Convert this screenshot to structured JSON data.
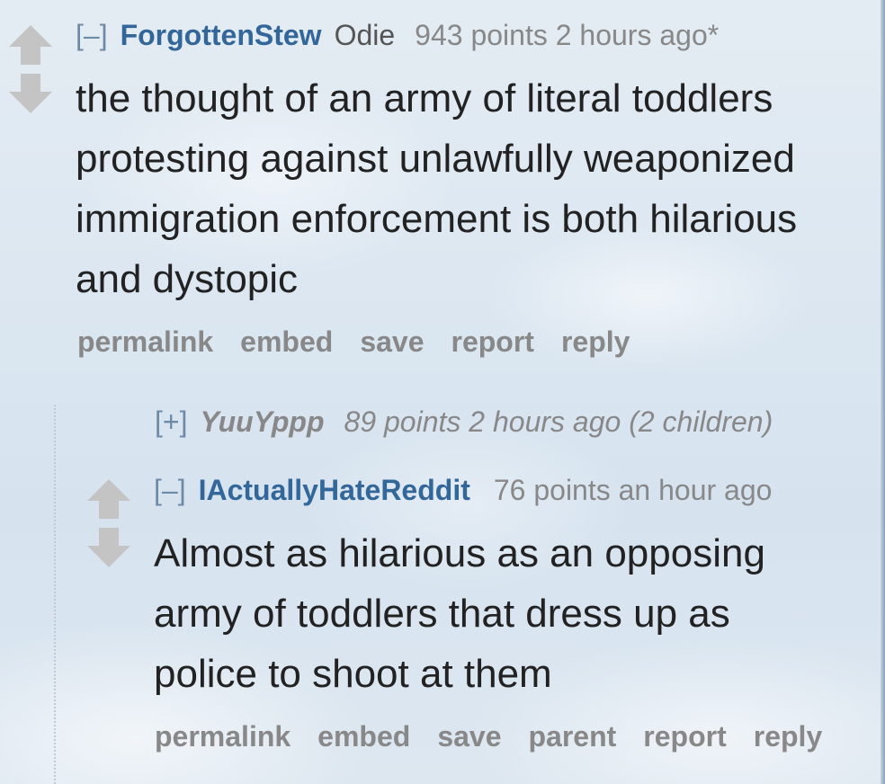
{
  "comments": [
    {
      "expand_toggle": "[–]",
      "author": "ForgottenStew",
      "flair": "Odie",
      "score": "943 points",
      "time": "2 hours ago*",
      "body": "the thought of an army of literal toddlers protesting against unlawfully weaponized immigration enforcement is both hilarious and dystopic",
      "buttons": [
        "permalink",
        "embed",
        "save",
        "report",
        "reply"
      ]
    },
    {
      "collapsed": true,
      "expand_toggle": "[+]",
      "author": "YuuYppp",
      "score": "89 points",
      "time": "2 hours ago",
      "children": "(2 children)"
    },
    {
      "expand_toggle": "[–]",
      "author": "IActuallyHateReddit",
      "score": "76 points",
      "time": "an hour ago",
      "body": "Almost as hilarious as an opposing army of toddlers that dress up as police to shoot at them",
      "buttons": [
        "permalink",
        "embed",
        "save",
        "parent",
        "report",
        "reply"
      ]
    }
  ],
  "colors": {
    "author": "#336699",
    "muted": "#888888",
    "body": "#222222",
    "arrow": "#c4c4c4"
  },
  "icons": {
    "upvote": "upvote-arrow-icon",
    "downvote": "downvote-arrow-icon"
  }
}
